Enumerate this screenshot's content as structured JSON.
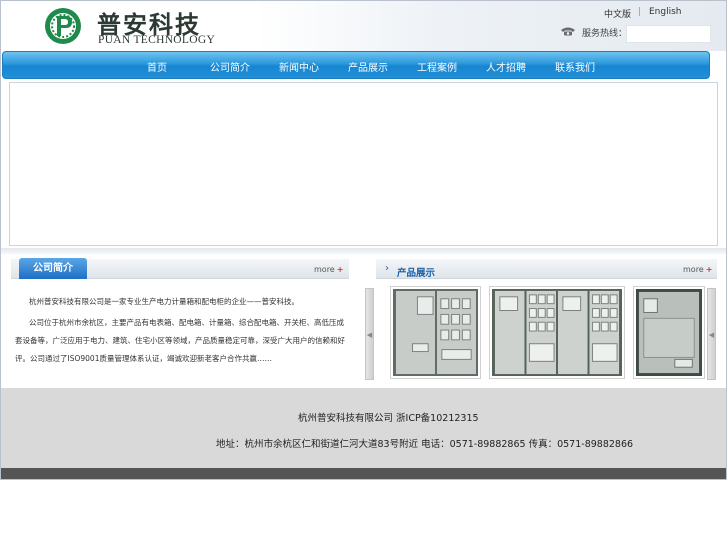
{
  "brand": {
    "name_cn": "普安科技",
    "name_en": "PUAN TECHNOLOGY",
    "logo_icon": "puan-logo-icon",
    "logo_color": "#1f8a4c"
  },
  "header": {
    "lang_cn": "中文版",
    "lang_sep": "|",
    "lang_en": "English",
    "hotline_icon": "phone-icon",
    "hotline_label": "服务热线："
  },
  "nav": {
    "items": [
      {
        "label": "首页"
      },
      {
        "label": "公司简介"
      },
      {
        "label": "新闻中心"
      },
      {
        "label": "产品展示"
      },
      {
        "label": "工程案例"
      },
      {
        "label": "人才招聘"
      },
      {
        "label": "联系我们"
      }
    ]
  },
  "about": {
    "title": "公司简介",
    "more": "more",
    "plus": "+",
    "para1": "杭州普安科技有限公司是一家专业生产电力计量箱和配电柜的企业——普安科技。",
    "para2": "公司位于杭州市余杭区，主要产品有电表箱、配电箱、计量箱、综合配电箱、开关柜、高低压成套设备等，广泛应用于电力、建筑、住宅小区等领域，产品质量稳定可靠，深受广大用户的信赖和好评。公司通过了ISO9001质量管理体系认证，竭诚欢迎新老客户合作共赢……"
  },
  "products": {
    "title": "产品展示",
    "chevron": "›",
    "more": "more",
    "plus": "+",
    "prev_arrow": "◀",
    "next_arrow": "◀"
  },
  "footer": {
    "line1": "杭州普安科技有限公司    浙ICP备10212315",
    "line2": "地址：杭州市余杭区仁和街道仁河大道83号附近  电话：0571-89882865  传真：0571-89882866"
  },
  "colors": {
    "nav_blue": "#1f8fd9",
    "footer_gray": "#d9d9d9",
    "bottom_bar": "#555555",
    "cabinet_gray": "#9aa09c",
    "cabinet_dark": "#3f4a44"
  }
}
